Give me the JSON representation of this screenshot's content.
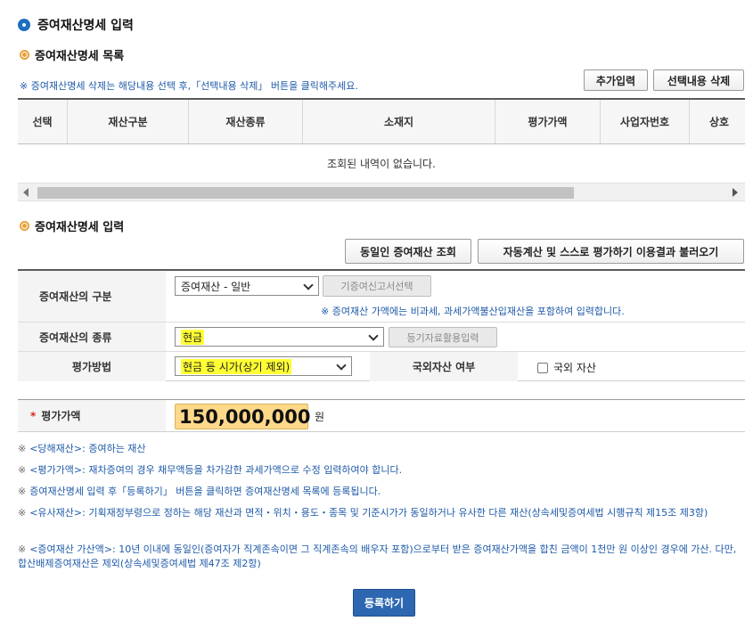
{
  "page_title": "증여재산명세 입력",
  "list_section": {
    "title": "증여재산명세 목록",
    "notice": "※ 증여재산명세 삭제는 해당내용 선택 후,「선택내용 삭제」 버튼을 클릭해주세요.",
    "add_button": "추가입력",
    "delete_button": "선택내용 삭제",
    "columns": [
      "선택",
      "재산구분",
      "재산종류",
      "소재지",
      "평가가액",
      "사업자번호",
      "상호"
    ],
    "empty_message": "조회된 내역이 없습니다."
  },
  "input_section": {
    "title": "증여재산명세 입력",
    "lookup_button": "동일인 증여재산 조회",
    "load_button": "자동계산 및 스스로 평가하기 이용결과 불러오기",
    "category_label": "증여재산의 구분",
    "category_value": "증여재산 - 일반",
    "prior_report_button": "기증여신고서선택",
    "category_note": "※ 증여재산 가액에는 비과세, 과세가액불산입재산을 포함하여 입력합니다.",
    "type_label": "증여재산의 종류",
    "type_value": "현금",
    "registry_button": "등기자료활용입력",
    "method_label": "평가방법",
    "method_value": "현금 등 시가(상기 제외)",
    "foreign_label": "국외자산 여부",
    "foreign_checkbox_label": "국외 자산",
    "amount_required_mark": "*",
    "amount_label": "평가가액",
    "amount_value": "150,000,000",
    "amount_unit": "원"
  },
  "notes": [
    "<당해재산>: 증여하는 재산",
    "<평가가액>: 재차증여의 경우 채무액등을 차가감한 과세가액으로 수정 입력하여야 합니다.",
    "증여재산명세 입력 후「등록하기」 버튼을 클릭하면 증여재산명세 목록에 등록됩니다.",
    "<유사재산>: 기획재정부령으로 정하는 해당 재산과 면적・위치・용도・종목 및 기준시가가 동일하거나 유사한 다른 재산(상속세및증여세법 시행규칙 제15조 제3항)",
    "<증여재산 가산액>: 10년 이내에 동일인(증여자가 직계존속이면 그 직계존속의 배우자 포함)으로부터 받은 증여재산가액을 합친 금액이 1천만 원 이상인 경우에 가산. 다만, 합산배제증여재산은 제외(상속세및증여세법 제47조 제2항)"
  ],
  "note_mark": "※",
  "register_button": "등록하기"
}
